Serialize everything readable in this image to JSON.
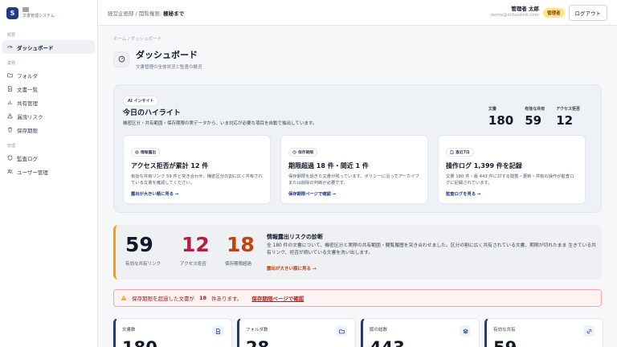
{
  "brand": {
    "logo_letter": "S",
    "name": "文書管理システム"
  },
  "sidebar": {
    "section_overview": "概要",
    "overview_items": [
      {
        "label": "ダッシュボード",
        "icon": "gauge-icon"
      }
    ],
    "section_business": "業務",
    "business_items": [
      {
        "label": "フォルダ",
        "icon": "folder-icon"
      },
      {
        "label": "文書一覧",
        "icon": "document-icon"
      },
      {
        "label": "共有管理",
        "icon": "bar-chart-icon"
      },
      {
        "label": "漏洩リスク",
        "icon": "warning-icon"
      },
      {
        "label": "保存期限",
        "icon": "trash-icon"
      }
    ],
    "section_admin": "管理",
    "admin_items": [
      {
        "label": "監査ログ",
        "icon": "shield-icon"
      },
      {
        "label": "ユーザー管理",
        "icon": "users-icon"
      }
    ]
  },
  "header": {
    "dept": "経営企画部 / 閲覧権限:",
    "scope": "極秘まで",
    "user_name": "管理者 太郎",
    "user_email": "demo@schoolink.com",
    "role": "管理者",
    "logout": "ログアウト"
  },
  "page": {
    "breadcrumb": "ホーム / ダッシュボード",
    "title": "ダッシュボード",
    "subtitle": "文書管理の全体状況と監査の概況"
  },
  "highlight": {
    "badge": "AI インサイト",
    "title": "今日のハイライト",
    "desc": "機密区分・共有範囲・保存期限の実データから、いま対応が必要な項目を自動で抽出しています。",
    "stats": [
      {
        "label": "文書",
        "value": "180"
      },
      {
        "label": "有効な共有",
        "value": "59"
      },
      {
        "label": "アクセス拒否",
        "value": "12"
      }
    ],
    "cards": [
      {
        "badge": "情報露出",
        "title": "アクセス拒否が累計 12 件",
        "desc": "有効な共有リンク 59 件と突き合わせ、機密区分の割に広く共有されている文書を確認してください。",
        "link": "露出が大きい順に見る →"
      },
      {
        "badge": "保存期限",
        "title": "期限超過 18 件・間近 1 件",
        "desc": "保存期限を過ぎた文書が残っています。ポリシーに沿ってアーカイブまたは削除の判断が必要です。",
        "link": "保存期限ページで確認 →"
      },
      {
        "badge": "直近7日",
        "title": "操作ログ 1,399 件を記録",
        "desc": "文書 180 件・版 443 件に対する閲覧・更新・共有の操作が監査ログに記録されています。",
        "link": "監査ログを見る →"
      }
    ]
  },
  "risk": {
    "items": [
      {
        "value": "59",
        "label": "有効な共有リンク",
        "color": "#111827"
      },
      {
        "value": "12",
        "label": "アクセス拒否",
        "color": "#b91c3c"
      },
      {
        "value": "18",
        "label": "保存期限超過",
        "color": "#c2410c"
      }
    ],
    "title": "情報露出リスクの診断",
    "desc": "全 180 件の文書について、機密区分と実際の共有範囲・閲覧履歴を突き合わせました。区分の割に広く共有されている文書、期限が切れたまま 生きている共有リンク、拒否が続いている文書を洗い出します。",
    "link": "露出が大きい順に見る →"
  },
  "alert": {
    "prefix": "保存期限を超過した文書が",
    "count": "18",
    "suffix": "件あります。",
    "link": "保存期限ページで確認"
  },
  "metrics": [
    {
      "label": "文書数",
      "value": "180",
      "icon": "document-icon"
    },
    {
      "label": "フォルダ数",
      "value": "28",
      "icon": "folder-icon"
    },
    {
      "label": "版の総数",
      "value": "443",
      "icon": "layers-icon"
    },
    {
      "label": "有効な共有",
      "value": "59",
      "icon": "link-icon"
    }
  ],
  "colors": {
    "accent": "#1e3a8a",
    "warning": "#f59e0b",
    "danger": "#b91c3c"
  }
}
